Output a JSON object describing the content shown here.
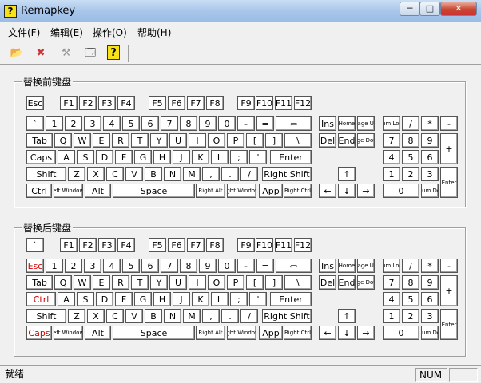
{
  "window": {
    "title": "Remapkey",
    "app_icon_glyph": "?",
    "controls": {
      "minimize": "─",
      "maximize": "□",
      "close": "✕"
    }
  },
  "menu": [
    "文件(F)",
    "编辑(E)",
    "操作(O)",
    "帮助(H)"
  ],
  "toolbar": [
    {
      "name": "open-icon",
      "glyph": "📂"
    },
    {
      "name": "reset-icon",
      "glyph": "✖"
    },
    {
      "name": "remap-icon",
      "glyph": "⚒"
    },
    {
      "name": "save-icon",
      "glyph": "🗔"
    },
    {
      "name": "help-icon",
      "glyph": "?"
    }
  ],
  "groups": {
    "base": {
      "title": "替换前键盘"
    },
    "remapped": {
      "title": "替换后键盘"
    }
  },
  "keyboards": {
    "base": {
      "row_fn": [
        "Esc",
        "F1",
        "F2",
        "F3",
        "F4",
        "F5",
        "F6",
        "F7",
        "F8",
        "F9",
        "F10",
        "F11",
        "F12"
      ],
      "row_num": [
        "`",
        "1",
        "2",
        "3",
        "4",
        "5",
        "6",
        "7",
        "8",
        "9",
        "0",
        "-",
        "=",
        "⇦"
      ],
      "row_q": [
        "Tab",
        "Q",
        "W",
        "E",
        "R",
        "T",
        "Y",
        "U",
        "I",
        "O",
        "P",
        "[",
        "]",
        "\\"
      ],
      "row_a": [
        "Caps",
        "A",
        "S",
        "D",
        "F",
        "G",
        "H",
        "J",
        "K",
        "L",
        ";",
        "'",
        "Enter"
      ],
      "row_z": [
        "Shift",
        "Z",
        "X",
        "C",
        "V",
        "B",
        "N",
        "M",
        ",",
        ".",
        "/",
        "Right Shift"
      ],
      "row_ctrl": [
        "Ctrl",
        "Left Windows",
        "Alt",
        "Space",
        "Right Alt",
        "Right Windows",
        "App",
        "Right Ctrl"
      ],
      "nav": [
        "Ins",
        "Home",
        "Page Up",
        "Del",
        "End",
        "Page Down"
      ],
      "arrows": [
        "↑",
        "←",
        "↓",
        "→"
      ],
      "numpad": [
        "Num Lock",
        "/",
        "*",
        "-",
        "7",
        "8",
        "9",
        "+",
        "4",
        "5",
        "6",
        "1",
        "2",
        "3",
        "Enter",
        "0",
        "Num Del"
      ]
    },
    "remapped": {
      "row_fn": [
        "`",
        "F1",
        "F2",
        "F3",
        "F4",
        "F5",
        "F6",
        "F7",
        "F8",
        "F9",
        "F10",
        "F11",
        "F12"
      ],
      "row_num": [
        "Esc",
        "1",
        "2",
        "3",
        "4",
        "5",
        "6",
        "7",
        "8",
        "9",
        "0",
        "-",
        "=",
        "⇦"
      ],
      "row_q": [
        "Tab",
        "Q",
        "W",
        "E",
        "R",
        "T",
        "Y",
        "U",
        "I",
        "O",
        "P",
        "[",
        "]",
        "\\"
      ],
      "row_a": [
        "Ctrl",
        "A",
        "S",
        "D",
        "F",
        "G",
        "H",
        "J",
        "K",
        "L",
        ";",
        "'",
        "Enter"
      ],
      "row_z": [
        "Shift",
        "Z",
        "X",
        "C",
        "V",
        "B",
        "N",
        "M",
        ",",
        ".",
        "/",
        "Right Shift"
      ],
      "row_ctrl": [
        "Caps",
        "Left Windows",
        "Alt",
        "Space",
        "Right Alt",
        "Right Windows",
        "App",
        "Right Ctrl"
      ],
      "nav": [
        "Ins",
        "Home",
        "Page Up",
        "Del",
        "End",
        "Page Down"
      ],
      "arrows": [
        "↑",
        "←",
        "↓",
        "→"
      ],
      "numpad": [
        "Num Lock",
        "/",
        "*",
        "-",
        "7",
        "8",
        "9",
        "+",
        "4",
        "5",
        "6",
        "1",
        "2",
        "3",
        "Enter",
        "0",
        "Num Del"
      ],
      "changed_key_color": "#d00000"
    }
  },
  "status": {
    "message": "就绪",
    "num": "NUM"
  }
}
